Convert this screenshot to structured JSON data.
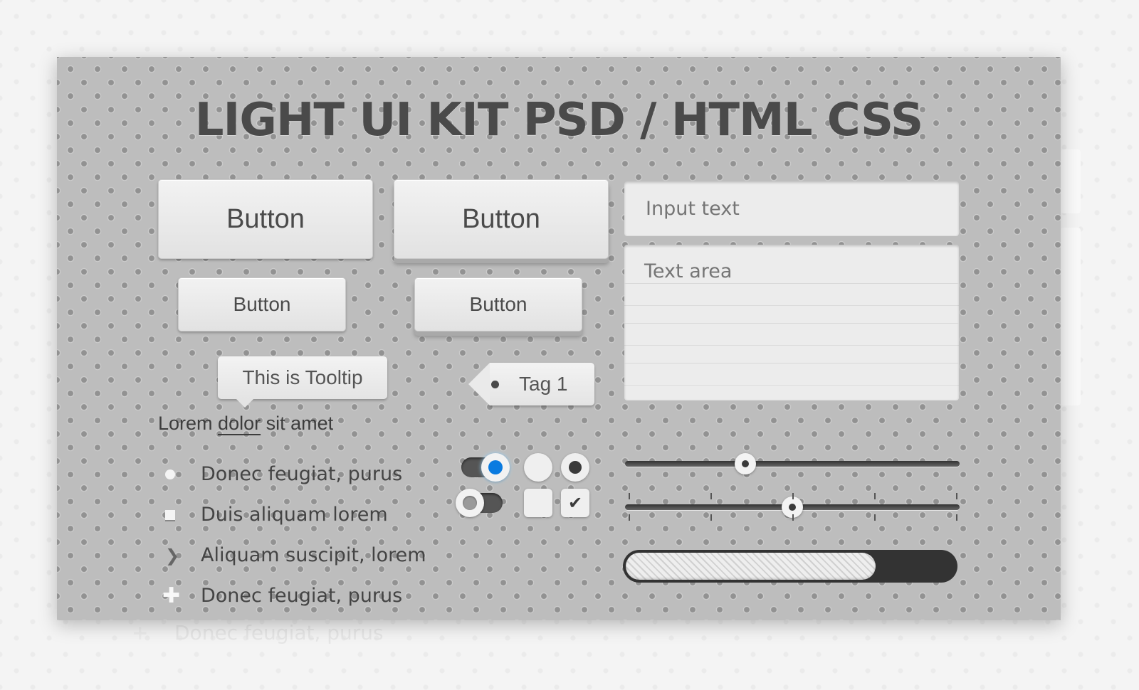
{
  "title": "LIGHT UI KIT PSD / HTML CSS",
  "buttons": {
    "large_flat": "Button",
    "large_raised": "Button",
    "small_flat": "Button",
    "small_raised": "Button"
  },
  "input": {
    "placeholder": "Input text"
  },
  "textarea": {
    "placeholder": "Text area"
  },
  "tooltip": {
    "text": "This is Tooltip"
  },
  "tag": {
    "label": "Tag 1"
  },
  "lorem": {
    "before": "Lorem ",
    "link": "dolor",
    "after": " sit amet"
  },
  "list": {
    "items": [
      {
        "bullet": "circle-icon",
        "label": "Donec feugiat, purus"
      },
      {
        "bullet": "square-icon",
        "label": "Duis aliquam lorem"
      },
      {
        "bullet": "chevron-right-icon",
        "label": "Aliquam suscipit, lorem"
      },
      {
        "bullet": "plus-icon",
        "label": "Donec feugiat, purus"
      }
    ]
  },
  "toggles": [
    {
      "state": "on",
      "accent": "#0a7be0"
    },
    {
      "state": "off"
    }
  ],
  "radios": [
    {
      "checked": false
    },
    {
      "checked": true
    }
  ],
  "checkboxes": [
    {
      "checked": false
    },
    {
      "checked": true,
      "mark": "✔"
    }
  ],
  "sliders": [
    {
      "value_percent": 36,
      "ticks": false
    },
    {
      "value_percent": 50,
      "ticks": true,
      "tick_count": 5
    }
  ],
  "progress": {
    "value_percent": 76
  },
  "reflection": {
    "label": "Donec feugiat, purus",
    "icon": "+"
  }
}
